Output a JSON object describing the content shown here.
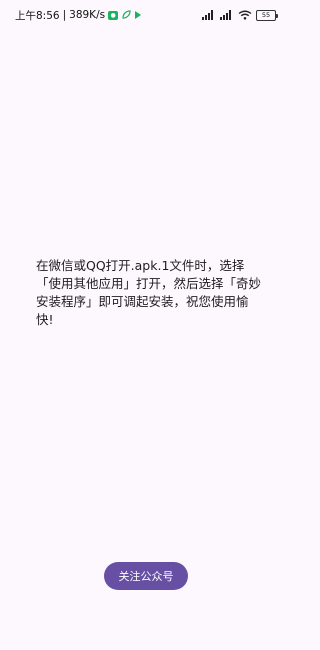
{
  "status_bar": {
    "time": "上午8:56",
    "network_speed": "389K/s",
    "battery_level": "55",
    "icons": [
      "app-badge-icon",
      "leaf-icon",
      "media-play-icon",
      "signal-icon",
      "signal-icon",
      "wifi-icon",
      "battery-icon"
    ]
  },
  "main": {
    "message": "在微信或QQ打开.apk.1文件时，选择「使用其他应用」打开，然后选择「奇妙安装程序」即可调起安装，祝您使用愉快!"
  },
  "actions": {
    "follow_label": "关注公众号"
  },
  "colors": {
    "background": "#FDF8FE",
    "button": "#6750A4",
    "button_text": "#FFFFFF"
  }
}
